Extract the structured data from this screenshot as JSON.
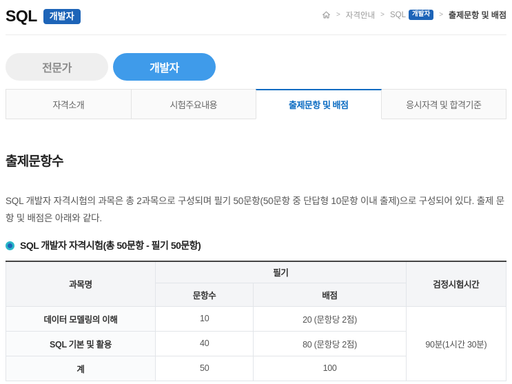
{
  "header": {
    "title": "SQL",
    "badge": "개발자"
  },
  "breadcrumb": {
    "separator": ">",
    "item_guide": "자격안내",
    "item_sql": "SQL",
    "item_sql_badge": "개발자",
    "current": "출제문항 및 배점"
  },
  "track_tabs": {
    "expert": "전문가",
    "developer": "개발자"
  },
  "section_tabs": [
    "자격소개",
    "시험주요내용",
    "출제문항 및 배점",
    "응시자격 및 합격기준"
  ],
  "content": {
    "heading": "출제문항수",
    "paragraph": "SQL 개발자 자격시험의 과목은 총 2과목으로 구성되며 필기 50문항(50문항 중 단답형 10문항 이내 출제)으로 구성되어 있다. 출제 문항 및 배점은 아래와 같다.",
    "subsection_title": "SQL 개발자 자격시험(총 50문항 - 필기 50문항)"
  },
  "exam_table": {
    "headers": {
      "subject": "과목명",
      "written": "필기",
      "question_count": "문항수",
      "points": "배점",
      "duration": "검정시험시간"
    },
    "rows": [
      {
        "subject": "데이터 모델링의 이해",
        "questions": "10",
        "points": "20 (문항당 2점)"
      },
      {
        "subject": "SQL 기본 및 활용",
        "questions": "40",
        "points": "80 (문항당 2점)"
      },
      {
        "subject": "계",
        "questions": "50",
        "points": "100"
      }
    ],
    "duration_value": "90분(1시간 30분)"
  },
  "colors": {
    "badge_blue": "#1d64b8",
    "pill_active_blue": "#3f9bea",
    "tab_active_blue": "#0c6cc2",
    "bullet_teal": "#2ab7c8"
  }
}
